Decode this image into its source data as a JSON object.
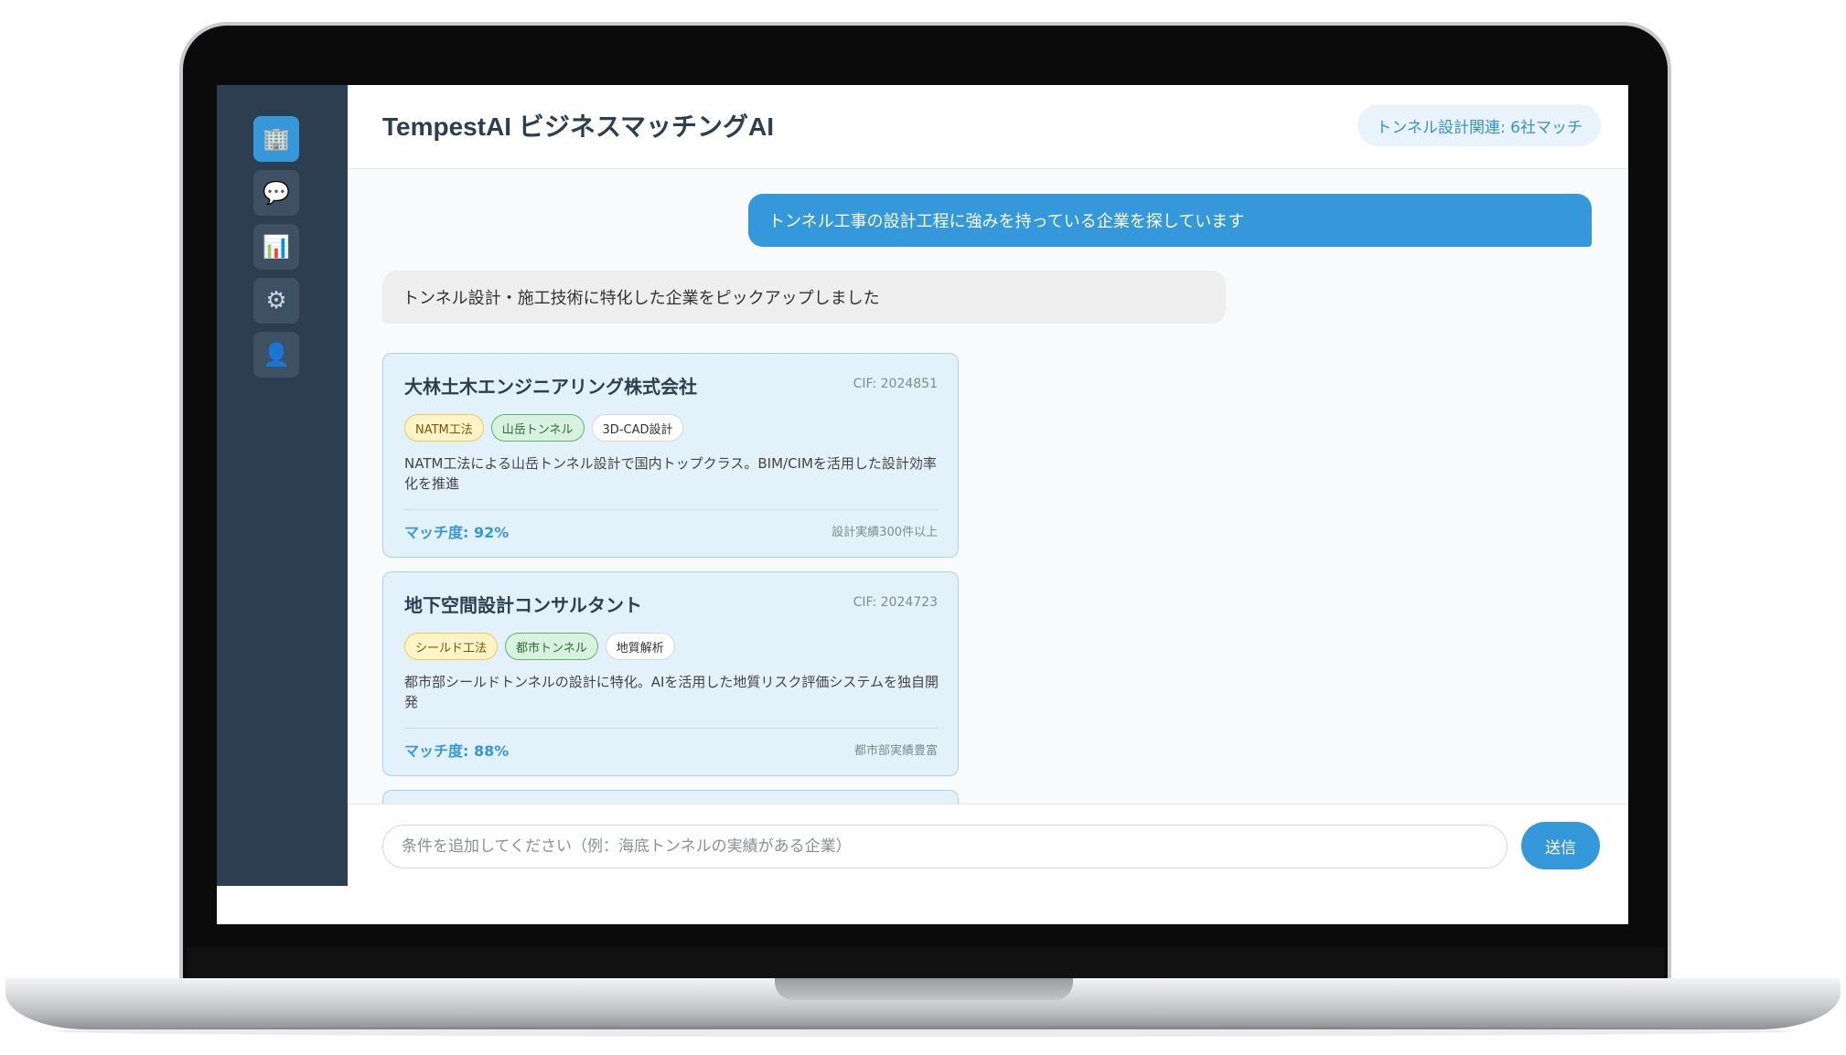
{
  "sidebar": {
    "items": [
      {
        "icon": "building-icon",
        "glyph": "🏢",
        "active": true
      },
      {
        "icon": "chat-bubble-icon",
        "glyph": "💬",
        "active": false
      },
      {
        "icon": "bar-chart-icon",
        "glyph": "📊",
        "active": false
      },
      {
        "icon": "gear-icon",
        "glyph": "⚙",
        "active": false
      },
      {
        "icon": "user-icon",
        "glyph": "👤",
        "active": false
      }
    ]
  },
  "header": {
    "title": "TempestAI ビジネスマッチングAI",
    "badge": "トンネル設計関連: 6社マッチ"
  },
  "chat": {
    "user_message": "トンネル工事の設計工程に強みを持っている企業を探しています",
    "ai_message": "トンネル設計・施工技術に特化した企業をピックアップしました",
    "cards": [
      {
        "name": "大林土木エンジニアリング株式会社",
        "cif": "CIF: 2024851",
        "tags": [
          {
            "label": "NATM工法",
            "color": "yellow"
          },
          {
            "label": "山岳トンネル",
            "color": "green"
          },
          {
            "label": "3D-CAD設計",
            "color": "white"
          }
        ],
        "description": "NATM工法による山岳トンネル設計で国内トップクラス。BIM/CIMを活用した設計効率化を推進",
        "match": "マッチ度: 92%",
        "note": "設計実績300件以上"
      },
      {
        "name": "地下空間設計コンサルタント",
        "cif": "CIF: 2024723",
        "tags": [
          {
            "label": "シールド工法",
            "color": "yellow"
          },
          {
            "label": "都市トンネル",
            "color": "green"
          },
          {
            "label": "地質解析",
            "color": "white"
          }
        ],
        "description": "都市部シールドトンネルの設計に特化。AIを活用した地質リスク評価システムを独自開発",
        "match": "マッチ度: 88%",
        "note": "都市部実績豊富"
      }
    ]
  },
  "input": {
    "placeholder": "条件を追加してください（例：海底トンネルの実績がある企業）",
    "value": "",
    "send_label": "送信"
  },
  "colors": {
    "accent": "#3498db",
    "sidebar_bg": "#2d3e50",
    "card_bg": "#e3f1fb"
  }
}
